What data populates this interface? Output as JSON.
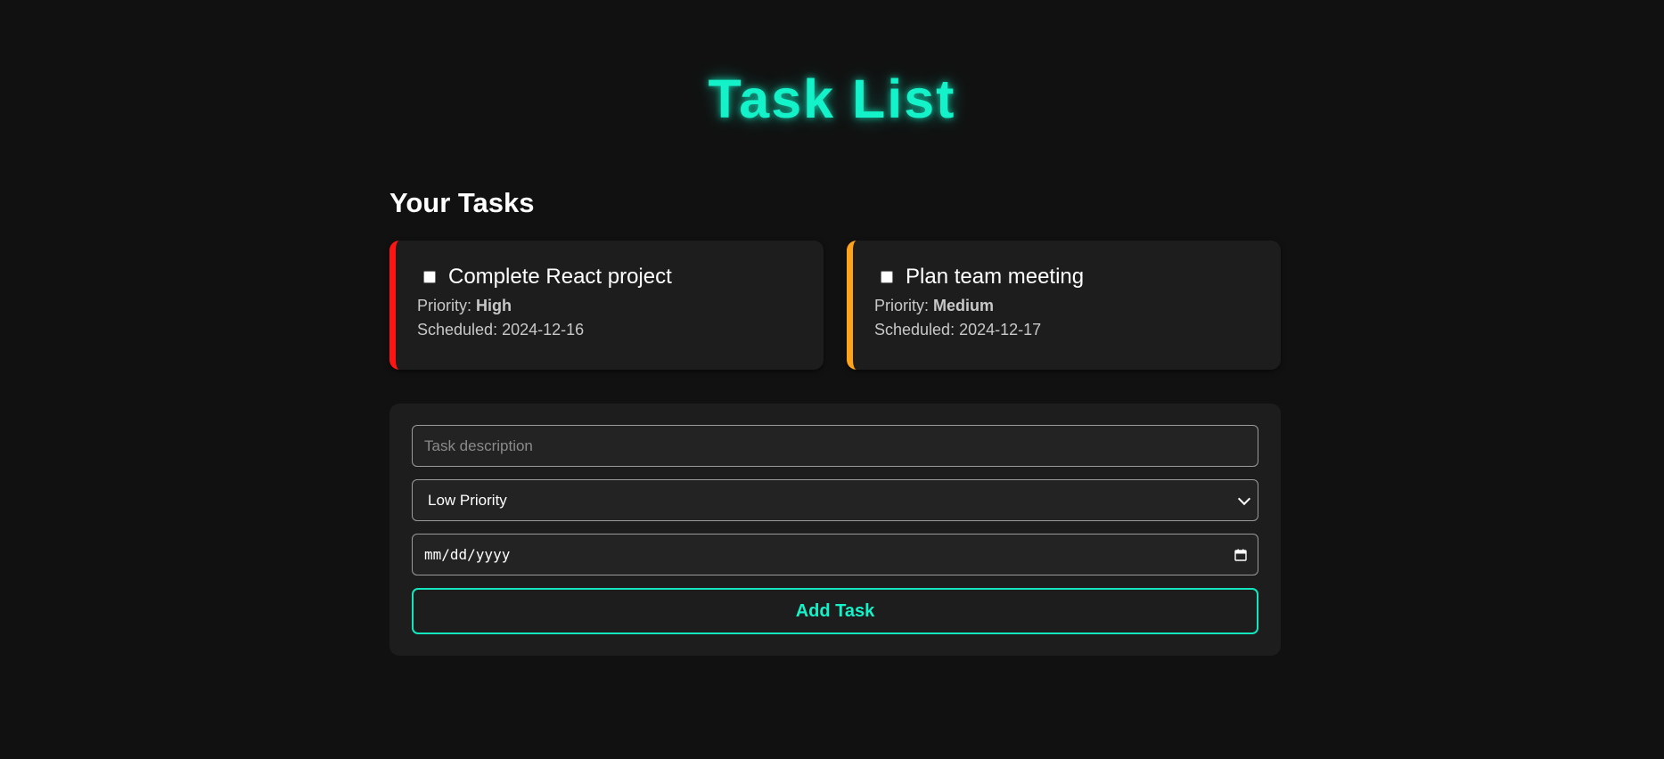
{
  "app": {
    "title": "Task List"
  },
  "tasks_section": {
    "heading": "Your Tasks",
    "priority_label": "Priority: ",
    "scheduled_label": "Scheduled: ",
    "tasks": [
      {
        "text": "Complete React project",
        "priority": "High",
        "scheduled": "2024-12-16",
        "completed": false,
        "accent_color": "#ff1414"
      },
      {
        "text": "Plan team meeting",
        "priority": "Medium",
        "scheduled": "2024-12-17",
        "completed": false,
        "accent_color": "#ffa31a"
      }
    ]
  },
  "form": {
    "description": {
      "placeholder": "Task description",
      "value": ""
    },
    "priority_select": {
      "selected": "Low Priority",
      "icon": "chevron-down-icon"
    },
    "date_input": {
      "placeholder": "mm/dd/yyyy",
      "icon": "calendar-icon"
    },
    "submit_label": "Add Task"
  },
  "colors": {
    "accent": "#13f2c8",
    "background": "#111111",
    "card": "#1d1d1d"
  }
}
